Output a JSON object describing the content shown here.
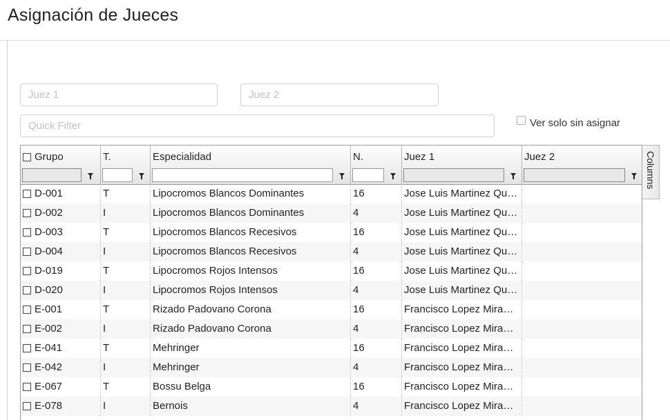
{
  "page": {
    "title": "Asignación de Jueces"
  },
  "filters": {
    "juez1_placeholder": "Juez 1",
    "juez2_placeholder": "Juez 2",
    "quick_placeholder": "Quick Filter",
    "unassigned_label": "Ver solo sin asignar",
    "unassigned_checked": false
  },
  "grid": {
    "columns": [
      "Grupo",
      "T.",
      "Especialidad",
      "N.",
      "Juez 1",
      "Juez 2"
    ],
    "columns_tab_label": "Columns",
    "rows": [
      [
        "D-001",
        "T",
        "Lipocromos Blancos Dominantes",
        "16",
        "Jose Luis Martinez Quesada",
        ""
      ],
      [
        "D-002",
        "I",
        "Lipocromos Blancos Dominantes",
        "4",
        "Jose Luis Martinez Quesada",
        ""
      ],
      [
        "D-003",
        "T",
        "Lipocromos Blancos Recesivos",
        "16",
        "Jose Luis Martinez Quesada",
        ""
      ],
      [
        "D-004",
        "I",
        "Lipocromos Blancos Recesivos",
        "4",
        "Jose Luis Martinez Quesada",
        ""
      ],
      [
        "D-019",
        "T",
        "Lipocromos Rojos Intensos",
        "16",
        "Jose Luis Martinez Quesada",
        ""
      ],
      [
        "D-020",
        "I",
        "Lipocromos Rojos Intensos",
        "4",
        "Jose Luis Martinez Quesada",
        ""
      ],
      [
        "E-001",
        "T",
        "Rizado Padovano Corona",
        "16",
        "Francisco Lopez Miranda",
        ""
      ],
      [
        "E-002",
        "I",
        "Rizado Padovano Corona",
        "4",
        "Francisco Lopez Miranda",
        ""
      ],
      [
        "E-041",
        "T",
        "Mehringer",
        "16",
        "Francisco Lopez Miranda",
        ""
      ],
      [
        "E-042",
        "I",
        "Mehringer",
        "4",
        "Francisco Lopez Miranda",
        ""
      ],
      [
        "E-067",
        "T",
        "Bossu Belga",
        "16",
        "Francisco Lopez Miranda",
        ""
      ],
      [
        "E-078",
        "I",
        "Bernois",
        "4",
        "Francisco Lopez Miranda",
        ""
      ]
    ]
  }
}
